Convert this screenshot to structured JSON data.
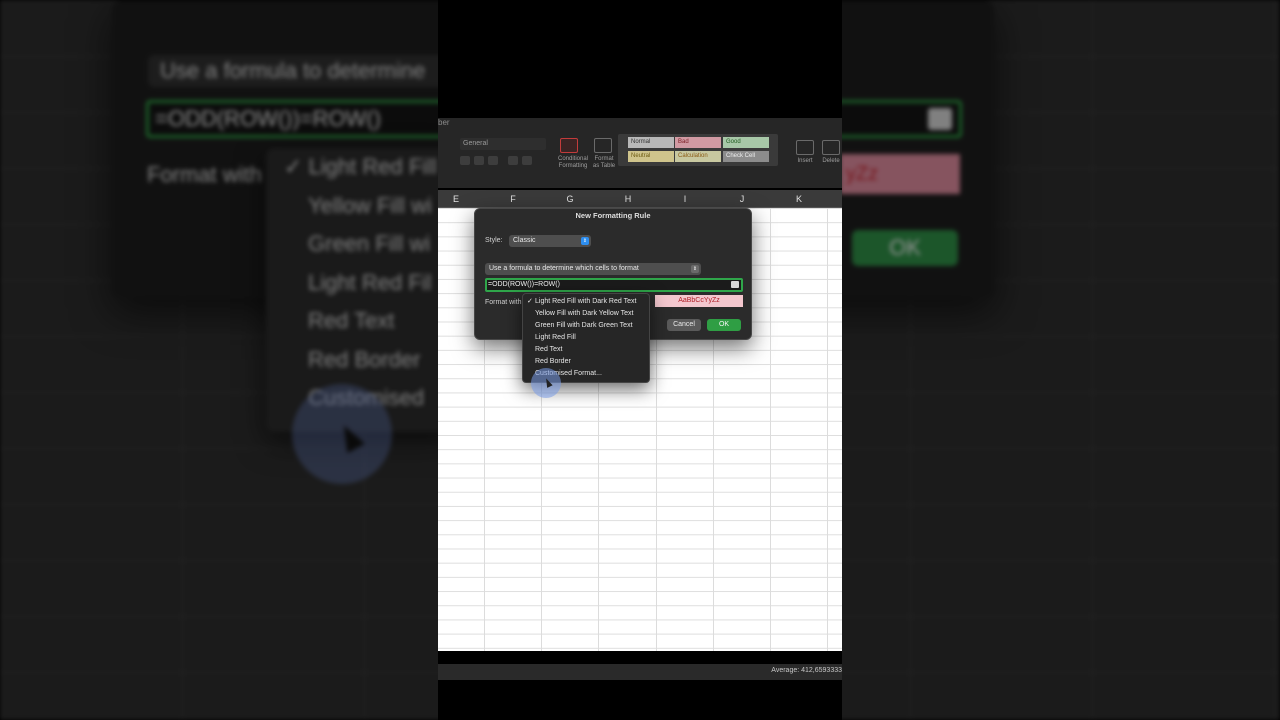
{
  "background": {
    "formula_label": "Use a formula to determine",
    "formula": "=ODD(ROW())=ROW()",
    "format_with": "Format with",
    "preview": "yZz",
    "ok": "OK",
    "menu": [
      "✓ Light Red Fill",
      "Yellow Fill wi",
      "Green Fill wi",
      "Light Red Fil",
      "Red Text",
      "Red Border",
      "Customised"
    ]
  },
  "ribbon": {
    "top_label": "ber",
    "number_format": "General",
    "conditional_formatting_line1": "Conditional",
    "conditional_formatting_line2": "Formatting",
    "format_as_table_line1": "Format",
    "format_as_table_line2": "as Table",
    "styles": [
      "Normal",
      "Bad",
      "Good",
      "Neutral",
      "Calculation",
      "Check Cell"
    ],
    "insert": "Insert",
    "delete": "Delete"
  },
  "columns": [
    "E",
    "F",
    "G",
    "H",
    "I",
    "J",
    "K"
  ],
  "dialog": {
    "title": "New Formatting Rule",
    "style_label": "Style:",
    "style_value": "Classic",
    "rule_type": "Use a formula to determine which cells to format",
    "formula": "=ODD(ROW())=ROW()",
    "format_with_label": "Format with",
    "preview": "AaBbCcYyZz",
    "cancel": "Cancel",
    "ok": "OK",
    "options": [
      {
        "label": "Light Red Fill with Dark Red Text",
        "checked": "✓"
      },
      {
        "label": "Yellow Fill with Dark Yellow Text",
        "checked": ""
      },
      {
        "label": "Green Fill with Dark Green Text",
        "checked": ""
      },
      {
        "label": "Light Red Fill",
        "checked": ""
      },
      {
        "label": "Red Text",
        "checked": ""
      },
      {
        "label": "Red Border",
        "checked": ""
      },
      {
        "label": "Customised Format...",
        "checked": ""
      }
    ]
  },
  "status": {
    "average": "Average: 412,6593333"
  }
}
